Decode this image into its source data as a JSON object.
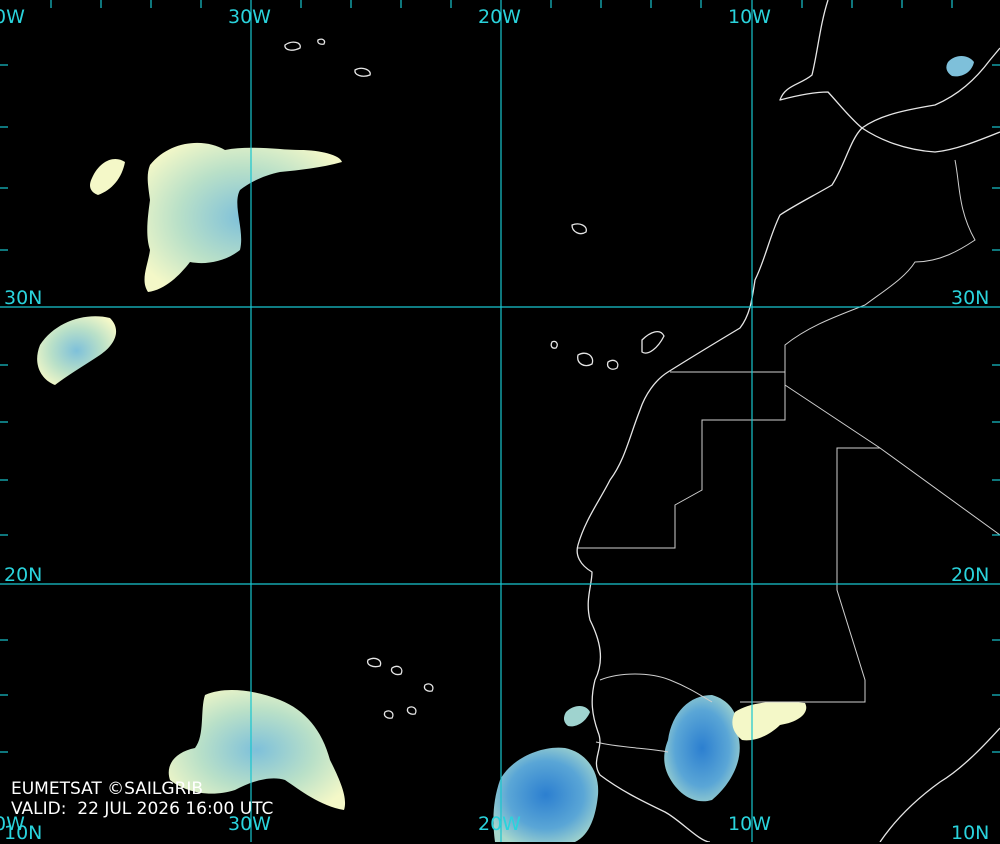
{
  "map": {
    "longitude_labels": {
      "top": [
        "0W",
        "30W",
        "20W",
        "10W"
      ],
      "bottom": [
        "0W",
        "10N",
        "30W",
        "20W",
        "10W",
        "10N"
      ]
    },
    "latitude_labels": {
      "left": [
        "30N",
        "20N"
      ],
      "right": [
        "30N",
        "20N"
      ]
    },
    "credit_line": "EUMETSAT ©SAILGRIB",
    "valid_line": "VALID:  22 JUL 2026 16:00 UTC",
    "colors": {
      "background": "#000000",
      "graticule": "#18c6cf",
      "coastline": "#e6e6e6",
      "cloud_light": "#f4f8c8",
      "cloud_mid": "#9fd3cf",
      "cloud_dense": "#2f86d4"
    }
  }
}
